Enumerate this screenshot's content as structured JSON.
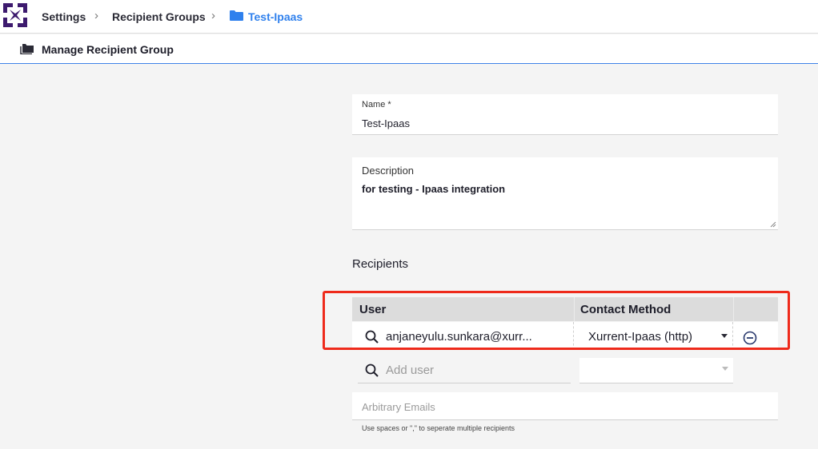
{
  "breadcrumb": {
    "items": [
      "Settings",
      "Recipient Groups",
      "Test-Ipaas"
    ]
  },
  "subheader": {
    "title": "Manage Recipient Group"
  },
  "form": {
    "name_label": "Name *",
    "name_value": "Test-Ipaas",
    "description_label": "Description",
    "description_value": "for testing - Ipaas integration"
  },
  "recipients": {
    "title": "Recipients",
    "columns": [
      "User",
      "Contact Method"
    ],
    "rows": [
      {
        "user": "anjaneyulu.sunkara@xurr...",
        "contact_method": "Xurrent-Ipaas (http)"
      }
    ],
    "add_user_placeholder": "Add user",
    "arbitrary_emails_placeholder": "Arbitrary Emails",
    "helper_text": "Use spaces or \",\" to seperate multiple recipients"
  },
  "colors": {
    "accent": "#2f80ed",
    "brand": "#3d1a6e",
    "highlight": "#ee2a1b"
  },
  "icons": [
    "app-logo-icon",
    "chevron-right-icon",
    "folder-icon",
    "search-icon",
    "chevron-down-icon",
    "remove-circle-icon"
  ]
}
